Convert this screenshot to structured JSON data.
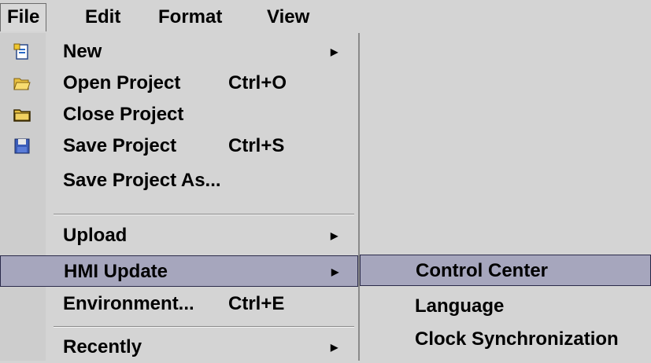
{
  "menubar": {
    "items": [
      {
        "label": "File",
        "active": true
      },
      {
        "label": "Edit"
      },
      {
        "label": "Format"
      },
      {
        "label": "View"
      }
    ]
  },
  "file_menu": {
    "items": [
      {
        "label": "New",
        "shortcut": "",
        "submenu": true,
        "icon": "new-document-icon"
      },
      {
        "label": "Open Project",
        "shortcut": "Ctrl+O",
        "icon": "open-folder-icon"
      },
      {
        "label": "Close Project",
        "shortcut": "",
        "icon": "closed-folder-icon"
      },
      {
        "label": "Save Project",
        "shortcut": "Ctrl+S",
        "icon": "floppy-disk-icon"
      },
      {
        "label": "Save Project As...",
        "shortcut": ""
      },
      {
        "label": "Upload",
        "shortcut": "",
        "submenu": true
      },
      {
        "label": "HMI Update",
        "shortcut": "",
        "submenu": true,
        "highlighted": true
      },
      {
        "label": "Environment...",
        "shortcut": "Ctrl+E"
      },
      {
        "label": "Recently",
        "shortcut": "",
        "submenu": true
      }
    ]
  },
  "hmi_update_submenu": {
    "items": [
      {
        "label": "Control Center",
        "highlighted": true
      },
      {
        "label": "Language"
      },
      {
        "label": "Clock Synchronization"
      }
    ]
  },
  "colors": {
    "menu_bg": "#d4d4d4",
    "highlight_bg": "#a6a6bd",
    "highlight_border": "#2a2a4a"
  }
}
